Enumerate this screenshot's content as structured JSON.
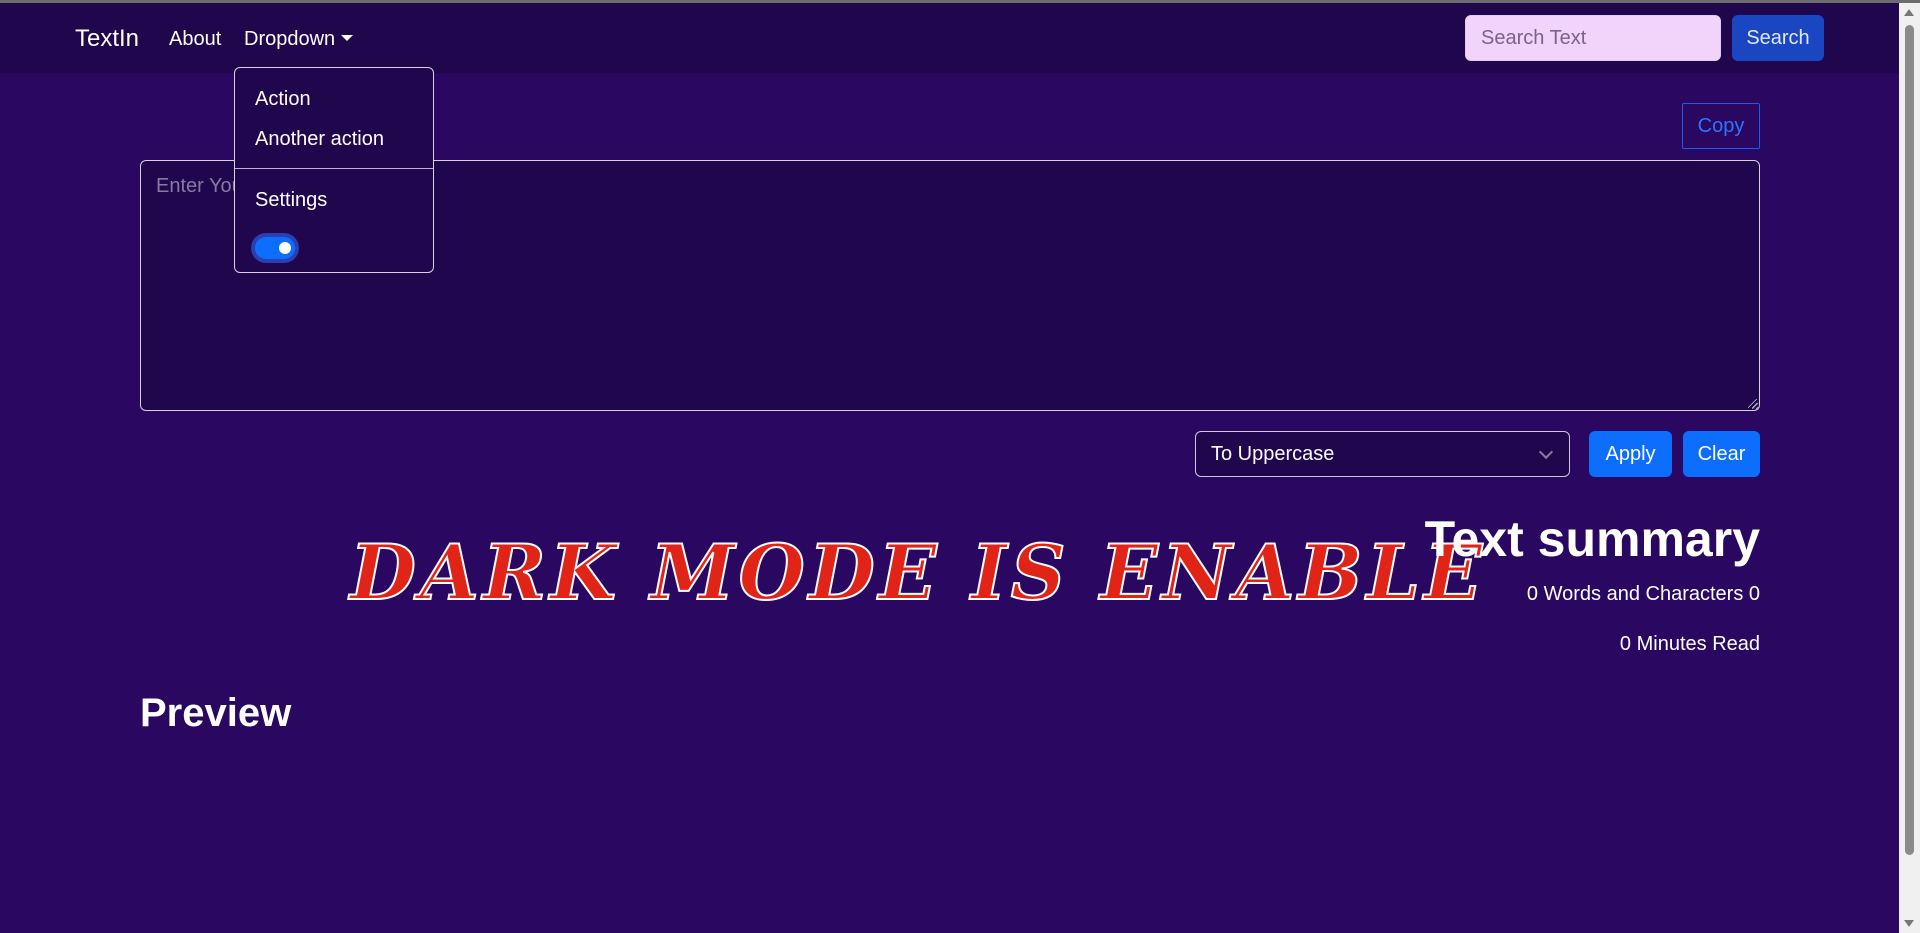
{
  "navbar": {
    "brand": "TextIn",
    "about": "About",
    "dropdown": "Dropdown",
    "search_placeholder": "Search Text",
    "search_button": "Search"
  },
  "dropdown_menu": {
    "action": "Action",
    "another_action": "Another action",
    "settings": "Settings",
    "dark_mode_toggle": true
  },
  "editor": {
    "copy_button": "Copy",
    "placeholder": "Enter Your Text Here",
    "value": ""
  },
  "controls": {
    "selected_transform": "To Uppercase",
    "apply_button": "Apply",
    "clear_button": "Clear"
  },
  "banner": {
    "text": "Dark Mode Is Enable"
  },
  "summary": {
    "title": "Text summary",
    "counts_line": "0 Words and Characters 0",
    "read_time": "0 Minutes Read"
  },
  "preview": {
    "title": "Preview"
  },
  "colors": {
    "page_bg": "#2a0760",
    "navbar_bg": "#1f064d",
    "primary": "#0d6efd",
    "banner_red": "#e02417"
  }
}
